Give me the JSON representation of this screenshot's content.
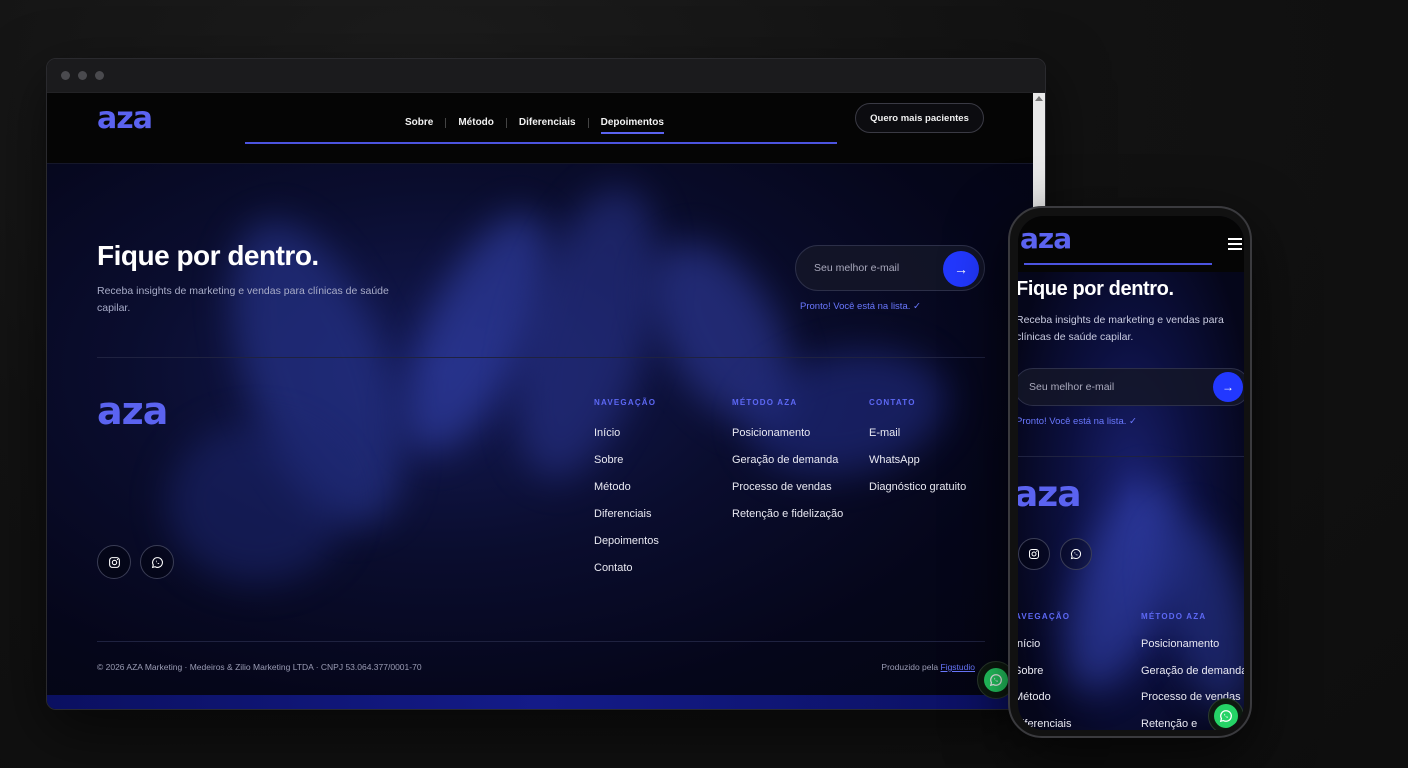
{
  "nav": {
    "logo": "aza",
    "links": [
      "Sobre",
      "Método",
      "Diferenciais",
      "Depoimentos"
    ],
    "active": "Depoimentos",
    "cta": "Quero mais pacientes"
  },
  "newsletter": {
    "title": "Fique por dentro.",
    "subtitle": "Receba insights de marketing e vendas para clínicas de saúde capilar.",
    "email_placeholder": "Seu melhor e-mail",
    "submit_icon": "→",
    "success": "Pronto! Você está na lista. ✓"
  },
  "footer": {
    "logo": "aza",
    "columns": [
      {
        "heading": "NAVEGAÇÃO",
        "items": [
          "Início",
          "Sobre",
          "Método",
          "Diferenciais",
          "Depoimentos",
          "Contato"
        ]
      },
      {
        "heading": "MÉTODO AZA",
        "items": [
          "Posicionamento",
          "Geração de demanda",
          "Processo de vendas",
          "Retenção e fidelização"
        ]
      },
      {
        "heading": "CONTATO",
        "items": [
          "E-mail",
          "WhatsApp",
          "Diagnóstico gratuito"
        ]
      }
    ],
    "social_icons": [
      "instagram-icon",
      "whatsapp-icon"
    ],
    "copyright": "© 2026 AZA Marketing · Medeiros & Zilio Marketing LTDA · CNPJ 53.064.377/0001-70",
    "produced_label": "Produzido pela",
    "produced_link": "Figstudio"
  },
  "mobile": {
    "logo": "aza",
    "title": "Fique por dentro.",
    "subtitle": "Receba insights de marketing e vendas para clínicas de saúde capilar.",
    "email_placeholder": "Seu melhor e-mail",
    "success": "Pronto! Você está na lista. ✓",
    "footer_logo": "aza",
    "col1_heading": "NAVEGAÇÃO",
    "col1_items": [
      "Início",
      "Sobre",
      "Método",
      "Diferenciais"
    ],
    "col2_heading": "MÉTODO AZA",
    "col2_items": [
      "Posicionamento",
      "Geração de demanda",
      "Processo de vendas",
      "Retenção e"
    ]
  },
  "colors": {
    "accent": "#5b63f0",
    "button_blue": "#2238ff",
    "whatsapp_green": "#25d366"
  }
}
